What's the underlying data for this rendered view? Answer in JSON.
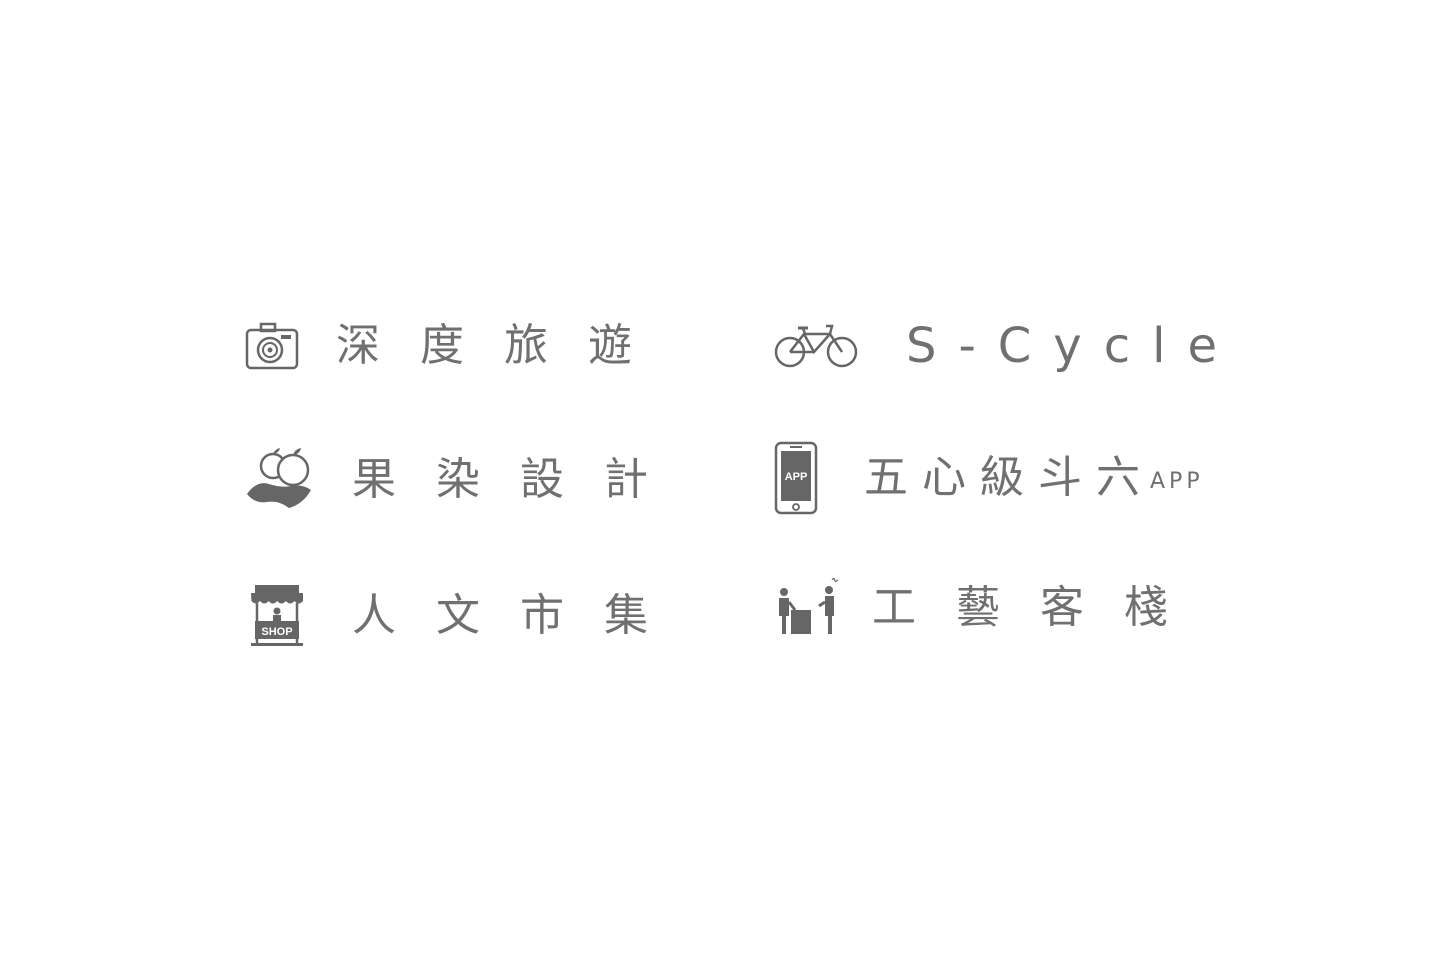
{
  "items": [
    {
      "label": "深度旅遊",
      "icon": "camera-icon"
    },
    {
      "label": "S-Cycle",
      "icon": "bicycle-icon"
    },
    {
      "label": "果染設計",
      "icon": "fruit-icon"
    },
    {
      "label": "五心級斗六",
      "suffix": "APP",
      "icon": "phone-app-icon",
      "icon_text": "APP"
    },
    {
      "label": "人文市集",
      "icon": "shop-stall-icon",
      "icon_text": "SHOP"
    },
    {
      "label": "工藝客棧",
      "icon": "artisans-icon"
    }
  ],
  "colors": {
    "text": "#707070",
    "icon": "#666666"
  }
}
